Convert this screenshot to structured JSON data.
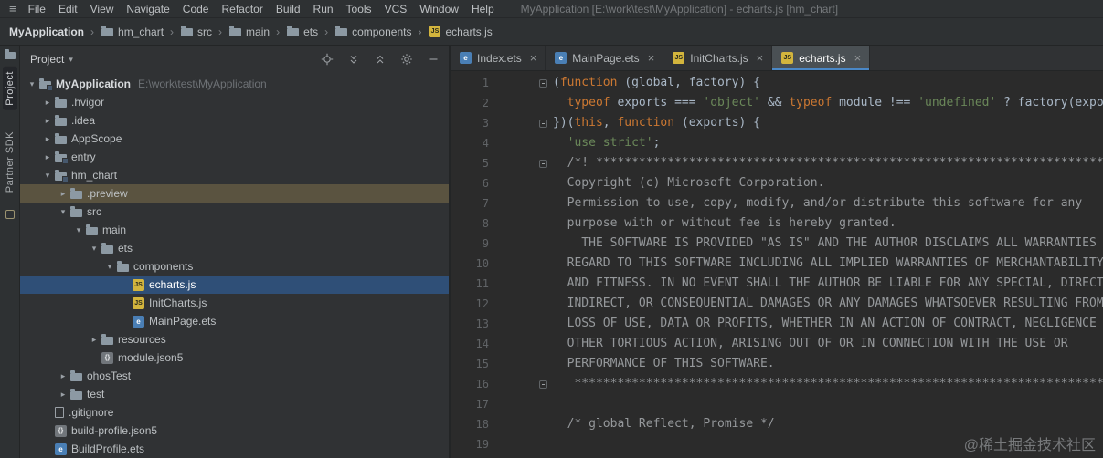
{
  "colors": {
    "editor_bg": "#2b2b2b",
    "panel_bg": "#303234",
    "bar_bg": "#2e3133",
    "tree_selection_blue": "#2f4f77",
    "tree_drop_highlight": "#5a5340",
    "keyword_orange": "#cc7832",
    "string_green": "#6a8759",
    "comment_gray": "#95989b",
    "plain_code": "#a9b7c6",
    "active_tab_underline": "#4a88c7"
  },
  "menu_bar": {
    "items": [
      "File",
      "Edit",
      "View",
      "Navigate",
      "Code",
      "Refactor",
      "Build",
      "Run",
      "Tools",
      "VCS",
      "Window",
      "Help"
    ],
    "title": "MyApplication [E:\\work\\test\\MyApplication] - echarts.js [hm_chart]"
  },
  "breadcrumbs": [
    {
      "label": "MyApplication",
      "icon": null
    },
    {
      "label": "hm_chart",
      "icon": "folder"
    },
    {
      "label": "src",
      "icon": "folder"
    },
    {
      "label": "main",
      "icon": "folder"
    },
    {
      "label": "ets",
      "icon": "folder"
    },
    {
      "label": "components",
      "icon": "folder"
    },
    {
      "label": "echarts.js",
      "icon": "js"
    }
  ],
  "activity_bar": {
    "project_label": "Project",
    "partner_sdk_label": "Partner SDK"
  },
  "project": {
    "header_title": "Project",
    "tree": [
      {
        "label": "MyApplication",
        "sub": "E:\\work\\test\\MyApplication",
        "depth": 0,
        "arrow": "open",
        "icon": "module",
        "bold": true
      },
      {
        "label": ".hvigor",
        "depth": 1,
        "arrow": "closed",
        "icon": "folder"
      },
      {
        "label": ".idea",
        "depth": 1,
        "arrow": "closed",
        "icon": "folder"
      },
      {
        "label": "AppScope",
        "depth": 1,
        "arrow": "closed",
        "icon": "folder"
      },
      {
        "label": "entry",
        "depth": 1,
        "arrow": "closed",
        "icon": "module"
      },
      {
        "label": "hm_chart",
        "depth": 1,
        "arrow": "open",
        "icon": "module"
      },
      {
        "label": ".preview",
        "depth": 2,
        "arrow": "closed",
        "icon": "folder",
        "state": "drop"
      },
      {
        "label": "src",
        "depth": 2,
        "arrow": "open",
        "icon": "folder"
      },
      {
        "label": "main",
        "depth": 3,
        "arrow": "open",
        "icon": "folder"
      },
      {
        "label": "ets",
        "depth": 4,
        "arrow": "open",
        "icon": "folder"
      },
      {
        "label": "components",
        "depth": 5,
        "arrow": "open",
        "icon": "folder"
      },
      {
        "label": "echarts.js",
        "depth": 6,
        "arrow": null,
        "icon": "js",
        "state": "selected"
      },
      {
        "label": "InitCharts.js",
        "depth": 6,
        "arrow": null,
        "icon": "js"
      },
      {
        "label": "MainPage.ets",
        "depth": 6,
        "arrow": null,
        "icon": "ets"
      },
      {
        "label": "resources",
        "depth": 4,
        "arrow": "closed",
        "icon": "folder"
      },
      {
        "label": "module.json5",
        "depth": 4,
        "arrow": null,
        "icon": "json"
      },
      {
        "label": "ohosTest",
        "depth": 2,
        "arrow": "closed",
        "icon": "folder"
      },
      {
        "label": "test",
        "depth": 2,
        "arrow": "closed",
        "icon": "folder"
      },
      {
        "label": ".gitignore",
        "depth": 1,
        "arrow": null,
        "icon": "file"
      },
      {
        "label": "build-profile.json5",
        "depth": 1,
        "arrow": null,
        "icon": "json"
      },
      {
        "label": "BuildProfile.ets",
        "depth": 1,
        "arrow": null,
        "icon": "ets"
      }
    ]
  },
  "editor": {
    "tabs": [
      {
        "label": "Index.ets",
        "icon": "ets",
        "active": false
      },
      {
        "label": "MainPage.ets",
        "icon": "ets",
        "active": false
      },
      {
        "label": "InitCharts.js",
        "icon": "js",
        "active": false
      },
      {
        "label": "echarts.js",
        "icon": "js",
        "active": true
      }
    ],
    "lines": [
      {
        "n": 1,
        "f": true,
        "t": [
          [
            "p",
            "("
          ],
          [
            "k",
            "function"
          ],
          [
            "p",
            " (global, factory) {"
          ]
        ]
      },
      {
        "n": 2,
        "f": false,
        "t": [
          [
            "p",
            "  "
          ],
          [
            "k",
            "typeof"
          ],
          [
            "p",
            " exports === "
          ],
          [
            "s",
            "'object'"
          ],
          [
            "p",
            " && "
          ],
          [
            "k",
            "typeof"
          ],
          [
            "p",
            " module !== "
          ],
          [
            "s",
            "'undefined'"
          ],
          [
            "p",
            " ? factory(exports) :"
          ]
        ]
      },
      {
        "n": 3,
        "f": true,
        "t": [
          [
            "p",
            "})("
          ],
          [
            "k",
            "this"
          ],
          [
            "p",
            ", "
          ],
          [
            "k",
            "function"
          ],
          [
            "p",
            " (exports) {"
          ]
        ]
      },
      {
        "n": 4,
        "f": false,
        "t": [
          [
            "p",
            "  "
          ],
          [
            "s",
            "'use strict'"
          ],
          [
            "p",
            ";"
          ]
        ]
      },
      {
        "n": 5,
        "f": true,
        "t": [
          [
            "c",
            "  /*! **********************************************************************************************"
          ]
        ]
      },
      {
        "n": 6,
        "f": false,
        "t": [
          [
            "c",
            "  Copyright (c) Microsoft Corporation."
          ]
        ]
      },
      {
        "n": 7,
        "f": false,
        "t": [
          [
            "c",
            "  Permission to use, copy, modify, and/or distribute this software for any"
          ]
        ]
      },
      {
        "n": 8,
        "f": false,
        "t": [
          [
            "c",
            "  purpose with or without fee is hereby granted."
          ]
        ]
      },
      {
        "n": 9,
        "f": false,
        "t": [
          [
            "c",
            "    THE SOFTWARE IS PROVIDED \"AS IS\" AND THE AUTHOR DISCLAIMS ALL WARRANTIES WITH"
          ]
        ]
      },
      {
        "n": 10,
        "f": false,
        "t": [
          [
            "c",
            "  REGARD TO THIS SOFTWARE INCLUDING ALL IMPLIED WARRANTIES OF MERCHANTABILITY"
          ]
        ]
      },
      {
        "n": 11,
        "f": false,
        "t": [
          [
            "c",
            "  AND FITNESS. IN NO EVENT SHALL THE AUTHOR BE LIABLE FOR ANY SPECIAL, DIRECT,"
          ]
        ]
      },
      {
        "n": 12,
        "f": false,
        "t": [
          [
            "c",
            "  INDIRECT, OR CONSEQUENTIAL DAMAGES OR ANY DAMAGES WHATSOEVER RESULTING FROM"
          ]
        ]
      },
      {
        "n": 13,
        "f": false,
        "t": [
          [
            "c",
            "  LOSS OF USE, DATA OR PROFITS, WHETHER IN AN ACTION OF CONTRACT, NEGLIGENCE OR"
          ]
        ]
      },
      {
        "n": 14,
        "f": false,
        "t": [
          [
            "c",
            "  OTHER TORTIOUS ACTION, ARISING OUT OF OR IN CONNECTION WITH THE USE OR"
          ]
        ]
      },
      {
        "n": 15,
        "f": false,
        "t": [
          [
            "c",
            "  PERFORMANCE OF THIS SOFTWARE."
          ]
        ]
      },
      {
        "n": 16,
        "f": true,
        "t": [
          [
            "c",
            "   ***************************************************************************** */"
          ]
        ]
      },
      {
        "n": 17,
        "f": false,
        "t": []
      },
      {
        "n": 18,
        "f": false,
        "t": [
          [
            "c",
            "  /* global Reflect, Promise */"
          ]
        ]
      },
      {
        "n": 19,
        "f": false,
        "t": []
      }
    ]
  },
  "watermark": "@稀土掘金技术社区"
}
